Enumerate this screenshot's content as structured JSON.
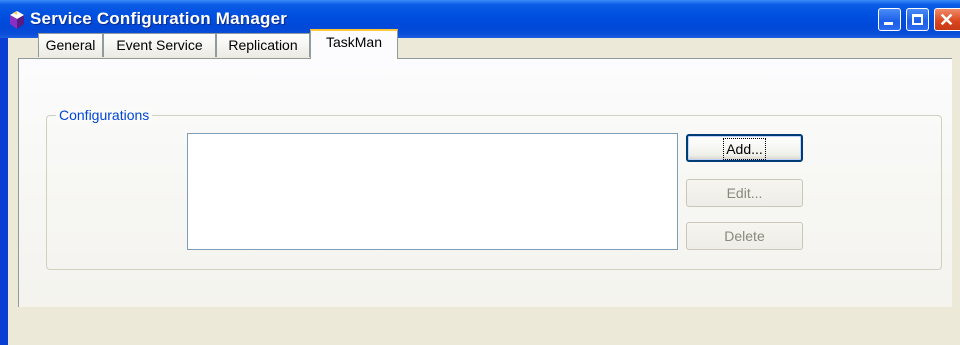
{
  "window": {
    "title": "Service Configuration Manager",
    "icon": "app-gem-icon",
    "controls": {
      "minimize": "minimize-icon",
      "maximize": "maximize-icon",
      "close": "✕"
    }
  },
  "tabs": [
    {
      "label": "General",
      "active": false
    },
    {
      "label": "Event Service",
      "active": false
    },
    {
      "label": "Replication",
      "active": false
    },
    {
      "label": "TaskMan",
      "active": true
    }
  ],
  "configurations": {
    "group_label": "Configurations",
    "items": [],
    "buttons": {
      "add": "Add...",
      "edit": "Edit...",
      "delete": "Delete"
    }
  },
  "colors": {
    "titlebar": "#0050e0",
    "active_tab_highlight": "#ffc83c",
    "group_label": "#0046d5"
  }
}
